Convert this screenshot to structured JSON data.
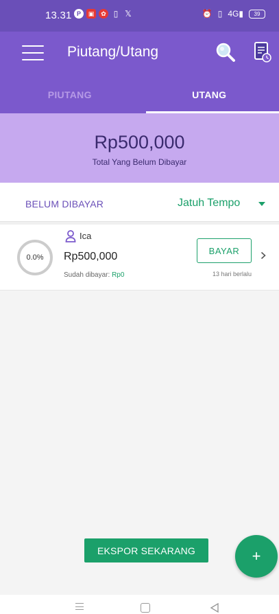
{
  "status_bar": {
    "time": "13.31",
    "icons": [
      "pinterest-icon",
      "notification-app-icon",
      "notification-app-icon",
      "vibrate-icon",
      "x-icon"
    ],
    "right_icons": [
      "alarm-icon",
      "vibrate-icon",
      "signal-icon"
    ],
    "signal_text": "4G",
    "battery": "39"
  },
  "app_bar": {
    "title": "Piutang/Utang",
    "icons": [
      "hamburger-menu-icon",
      "search-icon",
      "report-icon"
    ]
  },
  "tabs": [
    {
      "label": "PIUTANG",
      "active": false
    },
    {
      "label": "UTANG",
      "active": true
    }
  ],
  "summary": {
    "amount": "Rp500,000",
    "label": "Total Yang Belum Dibayar"
  },
  "filter": {
    "status_label": "BELUM DIBAYAR",
    "sort_label": "Jatuh Tempo"
  },
  "debts": [
    {
      "name": "Ica",
      "amount": "Rp500,000",
      "progress_text": "0.0%",
      "progress_fraction": 0.0,
      "paid_label": "Sudah dibayar:",
      "paid_value": "Rp0",
      "pay_button": "BAYAR",
      "time_ago": "13 hari berlalu"
    }
  ],
  "actions": {
    "export_label": "EKSPOR SEKARANG",
    "fab_label": "+"
  },
  "colors": {
    "primary": "#7b59cc",
    "primary_dark": "#6a4fb8",
    "summary_bg": "#c6a9ef",
    "accent_green": "#1ba06a"
  }
}
